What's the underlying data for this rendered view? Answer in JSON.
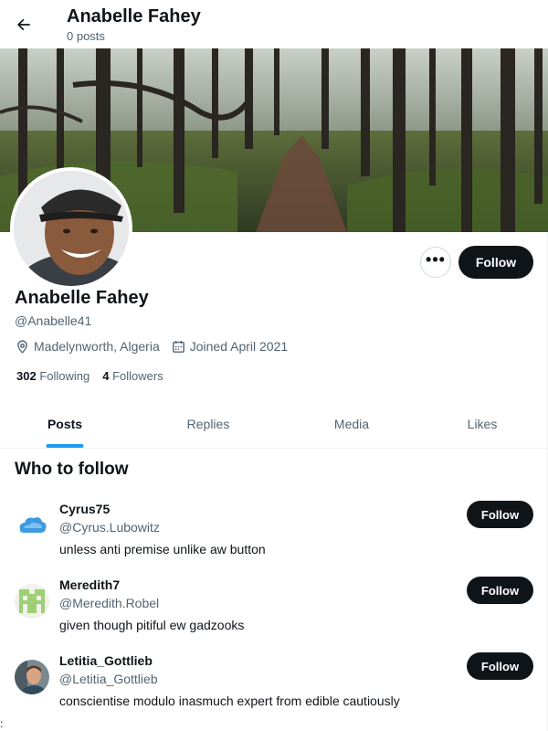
{
  "header": {
    "title": "Anabelle Fahey",
    "subtitle": "0 posts",
    "back_icon": "arrow-left-icon"
  },
  "profile": {
    "display_name": "Anabelle Fahey",
    "handle": "@Anabelle41",
    "location": "Madelynworth, Algeria",
    "joined": "Joined April 2021",
    "following_count": "302",
    "following_label": "Following",
    "followers_count": "4",
    "followers_label": "Followers",
    "follow_label": "Follow",
    "more_label": "•••"
  },
  "tabs": [
    {
      "label": "Posts",
      "active": true
    },
    {
      "label": "Replies",
      "active": false
    },
    {
      "label": "Media",
      "active": false
    },
    {
      "label": "Likes",
      "active": false
    }
  ],
  "who_to_follow": {
    "title": "Who to follow",
    "items": [
      {
        "name": "Cyrus75",
        "handle": "@Cyrus.Lubowitz",
        "bio": "unless anti premise unlike aw button",
        "follow_label": "Follow"
      },
      {
        "name": "Meredith7",
        "handle": "@Meredith.Robel",
        "bio": "given though pitiful ew gadzooks",
        "follow_label": "Follow"
      },
      {
        "name": "Letitia_Gottlieb",
        "handle": "@Letitia_Gottlieb",
        "bio": "conscientise modulo inasmuch expert from edible cautiously",
        "follow_label": "Follow"
      }
    ]
  },
  "footer_mark": ":",
  "colors": {
    "accent": "#1d9bf0",
    "button_dark": "#0f1419",
    "secondary_text": "#536471"
  }
}
